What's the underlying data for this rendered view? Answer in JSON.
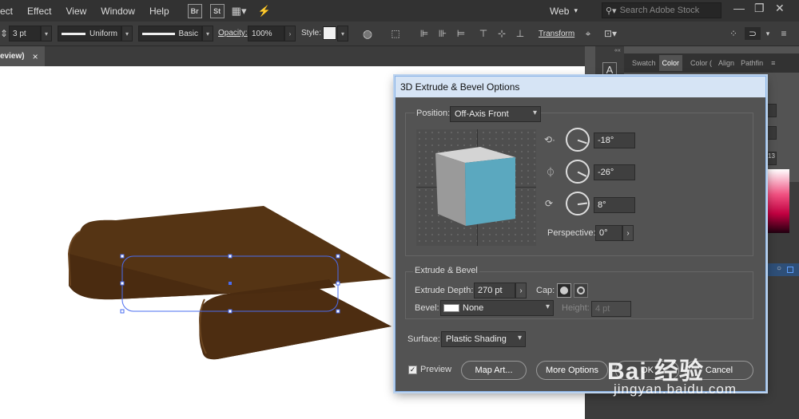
{
  "menubar": {
    "items": [
      "ect",
      "Effect",
      "View",
      "Window",
      "Help"
    ],
    "app_badges": [
      "Br",
      "St"
    ],
    "workspace": "Web",
    "search_placeholder": "Search Adobe Stock"
  },
  "controlbar": {
    "stroke_weight": "3 pt",
    "profile_uniform": "Uniform",
    "brush_basic": "Basic",
    "opacity_label": "Opacity:",
    "opacity_value": "100%",
    "style_label": "Style:",
    "transform_label": "Transform"
  },
  "document_tab": {
    "label": "eview)",
    "close_glyph": "×"
  },
  "panels": {
    "tabs": [
      "Swatch",
      "Color",
      "Color (",
      "Align",
      "Pathfin"
    ],
    "value_13": "13"
  },
  "dialog": {
    "title": "3D Extrude & Bevel Options",
    "position_label": "Position:",
    "position_value": "Off-Axis Front",
    "rotation_x": "-18°",
    "rotation_y": "-26°",
    "rotation_z": "8°",
    "perspective_label": "Perspective:",
    "perspective_value": "0°",
    "extrude_group_label": "Extrude & Bevel",
    "extrude_depth_label": "Extrude Depth:",
    "extrude_depth_value": "270 pt",
    "cap_label": "Cap:",
    "bevel_label": "Bevel:",
    "bevel_value": "None",
    "height_label": "Height:",
    "height_value": "4 pt",
    "surface_label": "Surface:",
    "surface_value": "Plastic Shading",
    "preview_label": "Preview",
    "preview_checked": true,
    "map_art_label": "Map Art...",
    "more_options_label": "More Options",
    "ok_label": "OK",
    "cancel_label": "Cancel"
  },
  "watermark": {
    "text": "Bai 经验",
    "url": "jingyan.baidu.com"
  },
  "colors": {
    "cube_front": "#5ba8bf",
    "cube_top": "#d4d4d4",
    "cube_side": "#9a9a9a",
    "object_fill": "#4a2c12",
    "selection": "#4a6cf0",
    "dialog_title_bg": "#d6e4f5"
  }
}
